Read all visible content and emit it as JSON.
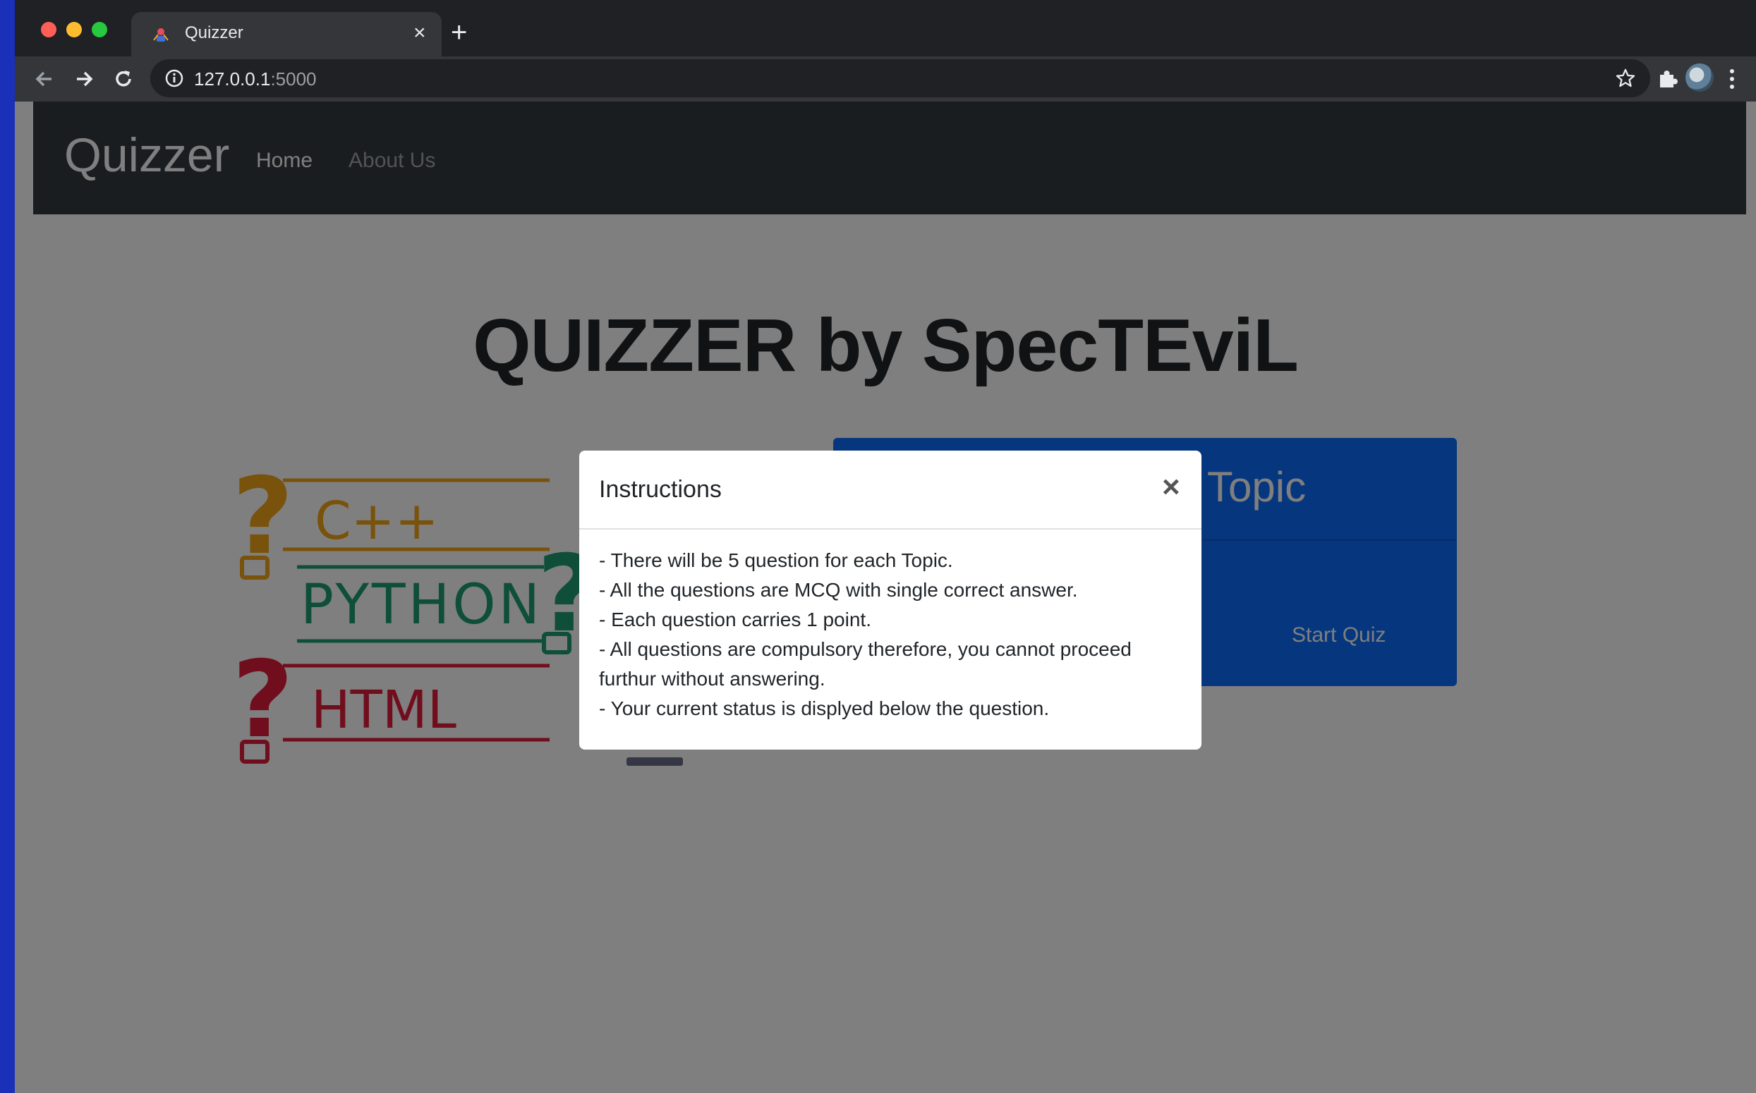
{
  "browser": {
    "tab_title": "Quizzer",
    "tab_close": "×",
    "new_tab": "+",
    "url_host": "127.0.0.1",
    "url_port": ":5000"
  },
  "navbar": {
    "brand": "Quizzer",
    "links": [
      "Home",
      "About Us"
    ]
  },
  "hero": {
    "title": "QUIZZER by SpecTEviL"
  },
  "logo": {
    "languages": [
      "C++",
      "PYTHON",
      "HTML"
    ],
    "colors": {
      "cpp": "#f2a417",
      "python": "#1f9e75",
      "html": "#e21d3c"
    }
  },
  "topic_card": {
    "title_visible": "Topic",
    "button": "Start Quiz",
    "color": "#0d6efd"
  },
  "modal": {
    "title": "Instructions",
    "close": "×",
    "lines": [
      "- There will be 5 question for each Topic.",
      "- All the questions are MCQ with single correct answer.",
      "- Each question carries 1 point.",
      "- All questions are compulsory therefore, you cannot proceed furthur without answering.",
      "- Your current status is displyed below the question."
    ]
  }
}
